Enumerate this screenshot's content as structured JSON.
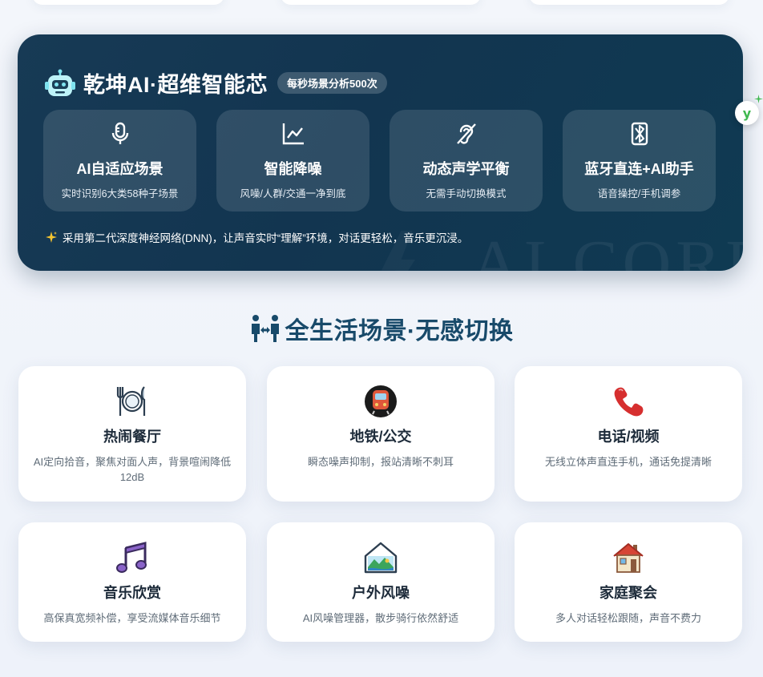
{
  "ai_card": {
    "title": "乾坤AI·超维智能芯",
    "badge": "每秒场景分析500次",
    "watermark": "AI CORE",
    "features": [
      {
        "icon": "microphone-icon",
        "title": "AI自适应场景",
        "sub": "实时识别6大类58种子场景"
      },
      {
        "icon": "line-chart-icon",
        "title": "智能降噪",
        "sub": "风噪/人群/交通一净到底"
      },
      {
        "icon": "hearing-icon",
        "title": "动态声学平衡",
        "sub": "无需手动切换模式"
      },
      {
        "icon": "bluetooth-box-icon",
        "title": "蓝牙直连+AI助手",
        "sub": "语音操控/手机调参"
      }
    ],
    "note": "采用第二代深度神经网络(DNN)，让声音实时“理解”环境，对话更轻松，音乐更沉浸。"
  },
  "side_button": {
    "label": "y"
  },
  "scenes_section": {
    "title": "全生活场景·无感切换",
    "items": [
      {
        "icon": "fork-knife-plate-icon",
        "title": "热闹餐厅",
        "desc": "AI定向拾音，聚焦对面人声，背景喧闹降低12dB"
      },
      {
        "icon": "metro-icon",
        "title": "地铁/公交",
        "desc": "瞬态噪声抑制，报站清晰不刺耳"
      },
      {
        "icon": "telephone-icon",
        "title": "电话/视频",
        "desc": "无线立体声直连手机，通话免提清晰"
      },
      {
        "icon": "music-note-icon",
        "title": "音乐欣赏",
        "desc": "高保真宽频补偿，享受流媒体音乐细节"
      },
      {
        "icon": "landscape-icon",
        "title": "户外风噪",
        "desc": "AI风噪管理器，散步骑行依然舒适"
      },
      {
        "icon": "house-icon",
        "title": "家庭聚会",
        "desc": "多人对话轻松跟随，声音不费力"
      }
    ]
  }
}
